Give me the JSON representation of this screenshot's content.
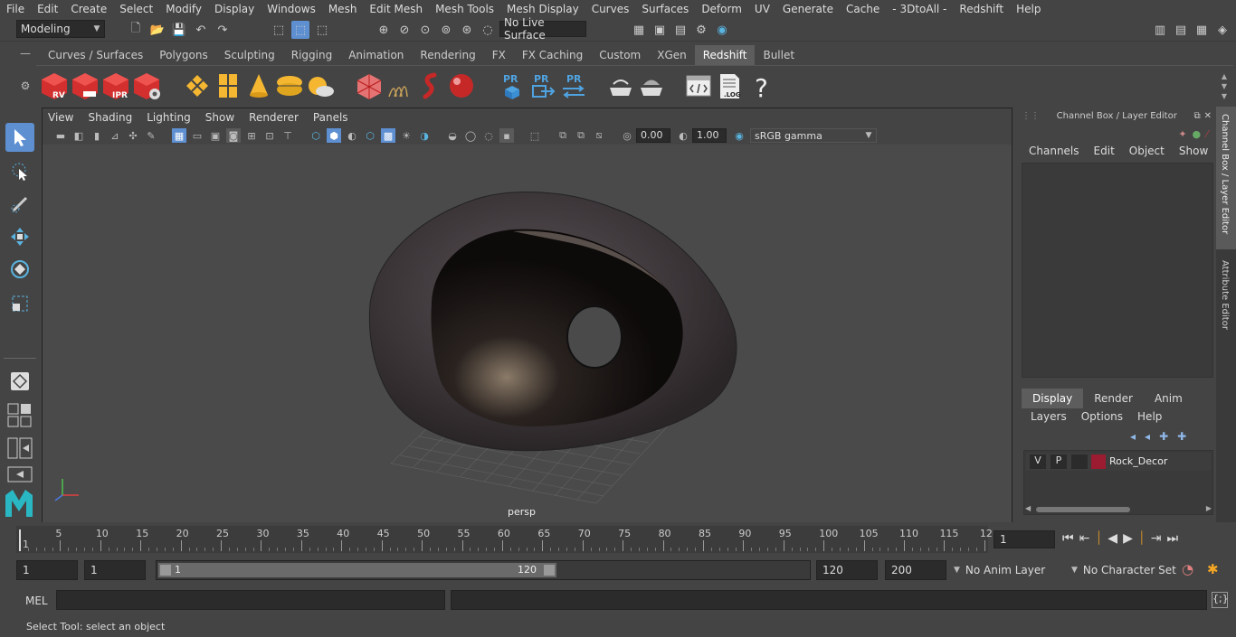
{
  "menus": [
    "File",
    "Edit",
    "Create",
    "Select",
    "Modify",
    "Display",
    "Windows",
    "Mesh",
    "Edit Mesh",
    "Mesh Tools",
    "Mesh Display",
    "Curves",
    "Surfaces",
    "Deform",
    "UV",
    "Generate",
    "Cache",
    "- 3DtoAll -",
    "Redshift",
    "Help"
  ],
  "workspace_mode": "Modeling",
  "live_surface": "No Live Surface",
  "shelf_tabs": [
    "Curves / Surfaces",
    "Polygons",
    "Sculpting",
    "Rigging",
    "Animation",
    "Rendering",
    "FX",
    "FX Caching",
    "Custom",
    "XGen",
    "Redshift",
    "Bullet"
  ],
  "active_shelf": "Redshift",
  "shelf_labels": {
    "rv": "RV",
    "ipr": "IPR",
    "pr": "PR",
    "log": ".LOG",
    "help": "?"
  },
  "viewport": {
    "menus": [
      "View",
      "Shading",
      "Lighting",
      "Show",
      "Renderer",
      "Panels"
    ],
    "exposure": "0.00",
    "gamma": "1.00",
    "color_space": "sRGB gamma",
    "camera_label": "persp"
  },
  "channel_box": {
    "title": "Channel Box / Layer Editor",
    "menus": [
      "Channels",
      "Edit",
      "Object",
      "Show"
    ],
    "layer_tabs": [
      "Display",
      "Render",
      "Anim"
    ],
    "layer_menus": [
      "Layers",
      "Options",
      "Help"
    ],
    "layer": {
      "v": "V",
      "p": "P",
      "name": "Rock_Decor",
      "color": "#9b1b30"
    }
  },
  "side_tabs": [
    "Channel Box / Layer Editor",
    "Attribute Editor"
  ],
  "timeline": {
    "ticks": [
      "5",
      "10",
      "15",
      "20",
      "25",
      "30",
      "35",
      "40",
      "45",
      "50",
      "55",
      "60",
      "65",
      "70",
      "75",
      "80",
      "85",
      "90",
      "95",
      "100",
      "105",
      "110",
      "115",
      "12"
    ],
    "start_marker": "1",
    "current_frame": "1"
  },
  "range": {
    "start": "1",
    "playback_start": "1",
    "slider_start": "1",
    "slider_end": "120",
    "playback_end": "120",
    "end": "200",
    "anim_layer": "No Anim Layer",
    "character_set": "No Character Set"
  },
  "command": {
    "label": "MEL"
  },
  "help_text": "Select Tool: select an object",
  "colors": {
    "accent": "#5d8fd1",
    "redshift_red": "#d32f2f",
    "layer_color": "#9b1b30"
  }
}
